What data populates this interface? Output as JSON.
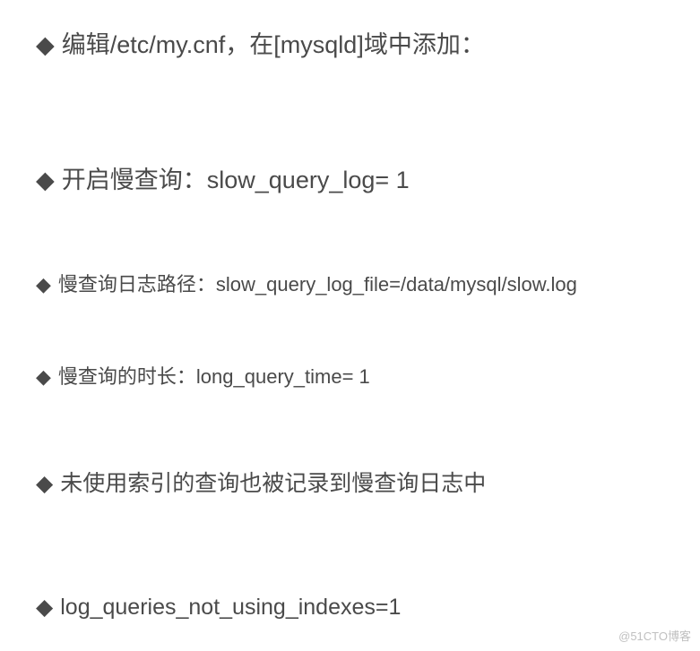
{
  "items": [
    "编辑/etc/my.cnf，在[mysqld]域中添加：",
    "开启慢查询：slow_query_log= 1",
    "慢查询日志路径：slow_query_log_file=/data/mysql/slow.log",
    "慢查询的时长：long_query_time= 1",
    "未使用索引的查询也被记录到慢查询日志中",
    "log_queries_not_using_indexes=1"
  ],
  "bullet": "◆",
  "watermark": "@51CTO博客"
}
